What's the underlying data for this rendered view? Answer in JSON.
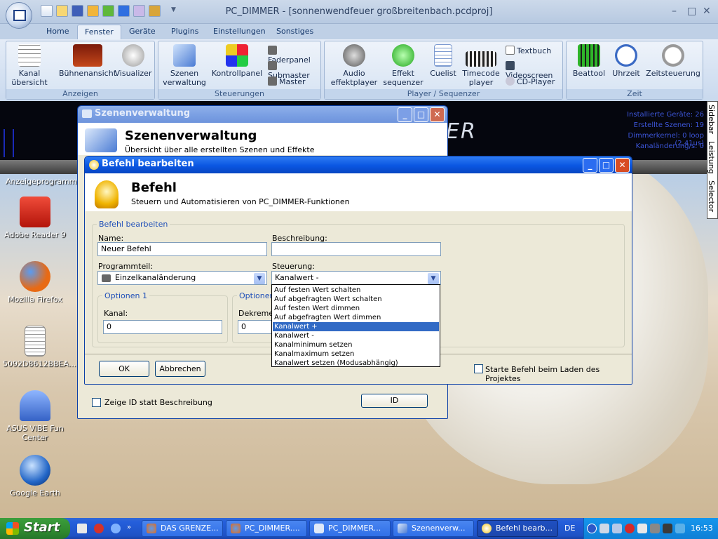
{
  "app": {
    "title": "PC_DIMMER - [sonnenwendfeuer großbreitenbach.pcdproj]",
    "tabs": [
      "Home",
      "Fenster",
      "Geräte",
      "Plugins",
      "Einstellungen",
      "Sonstiges"
    ],
    "active_tab": "Fenster",
    "groups": {
      "anzeigen": {
        "label": "Anzeigen",
        "buttons": [
          "Kanal übersicht",
          "Bühnenansicht",
          "Visualizer"
        ]
      },
      "steuerungen": {
        "label": "Steuerungen",
        "buttons": [
          "Szenen verwaltung",
          "Kontrollpanel"
        ],
        "small": [
          "Faderpanel",
          "Submaster",
          "Master"
        ]
      },
      "player": {
        "label": "Player / Sequenzer",
        "buttons": [
          "Audio effektplayer",
          "Effekt sequenzer",
          "Cuelist",
          "Timecode player"
        ],
        "small": [
          "Textbuch",
          "Videoscreen",
          "CD-Player"
        ]
      },
      "zeit": {
        "label": "Zeit",
        "buttons": [
          "Beattool",
          "Uhrzeit",
          "Zeitsteuerung"
        ]
      }
    },
    "status": [
      "Installierte Geräte: 26",
      "Erstellte Szenen: 19",
      "Dimmerkernel: 0 loop (2,41us)",
      "Kanaländerung/s: 0"
    ],
    "sidebar_tabs": [
      "Sidebar",
      "Leistung",
      "Selector"
    ],
    "anzeigeprogramm": "Anzeigeprogramm",
    "band_letters": "ER"
  },
  "desktop": {
    "icons": [
      "Adobe Reader 9",
      "Mozilla Firefox",
      "5092D8612BBEA...",
      "ASUS VIBE Fun Center",
      "Google Earth"
    ]
  },
  "szenen": {
    "title": "Szenenverwaltung",
    "heading": "Szenenverwaltung",
    "subtitle": "Übersicht über alle erstellten Szenen und Effekte",
    "show_id_label": "Zeige ID statt Beschreibung",
    "id_button": "ID"
  },
  "befehl": {
    "title": "Befehl bearbeiten",
    "heading": "Befehl",
    "subtitle": "Steuern und Automatisieren von PC_DIMMER-Funktionen",
    "group_label": "Befehl bearbeiten",
    "name_label": "Name:",
    "name_value": "Neuer Befehl",
    "desc_label": "Beschreibung:",
    "desc_value": "",
    "prog_label": "Programmteil:",
    "prog_value": "Einzelkanaländerung",
    "steuer_label": "Steuerung:",
    "steuer_value": "Kanalwert -",
    "opt1_label": "Optionen 1",
    "opt2_label": "Optionen",
    "kanal_label": "Kanal:",
    "kanal_value": "0",
    "dekrement_label": "Dekremen",
    "dekrement_value": "0",
    "ok": "OK",
    "cancel": "Abbrechen",
    "start_on_load": "Starte Befehl beim Laden des Projektes",
    "options": [
      "Auf festen Wert schalten",
      "Auf abgefragten Wert schalten",
      "Auf festen Wert dimmen",
      "Auf abgefragten Wert dimmen",
      "Kanalwert +",
      "Kanalwert -",
      "Kanalminimum setzen",
      "Kanalmaximum setzen",
      "Kanalwert setzen (Modusabhängig)"
    ],
    "selected_option_index": 4
  },
  "taskbar": {
    "start": "Start",
    "tasks": [
      "DAS GRENZE...",
      "PC_DIMMER....",
      "PC_DIMMER...",
      "Szenenverw...",
      "Befehl bearb..."
    ],
    "lang": "DE",
    "clock": "16:53"
  },
  "colors": {
    "accent": "#0a56e2",
    "selection": "#316ac5",
    "status_text": "#3c55d8"
  }
}
